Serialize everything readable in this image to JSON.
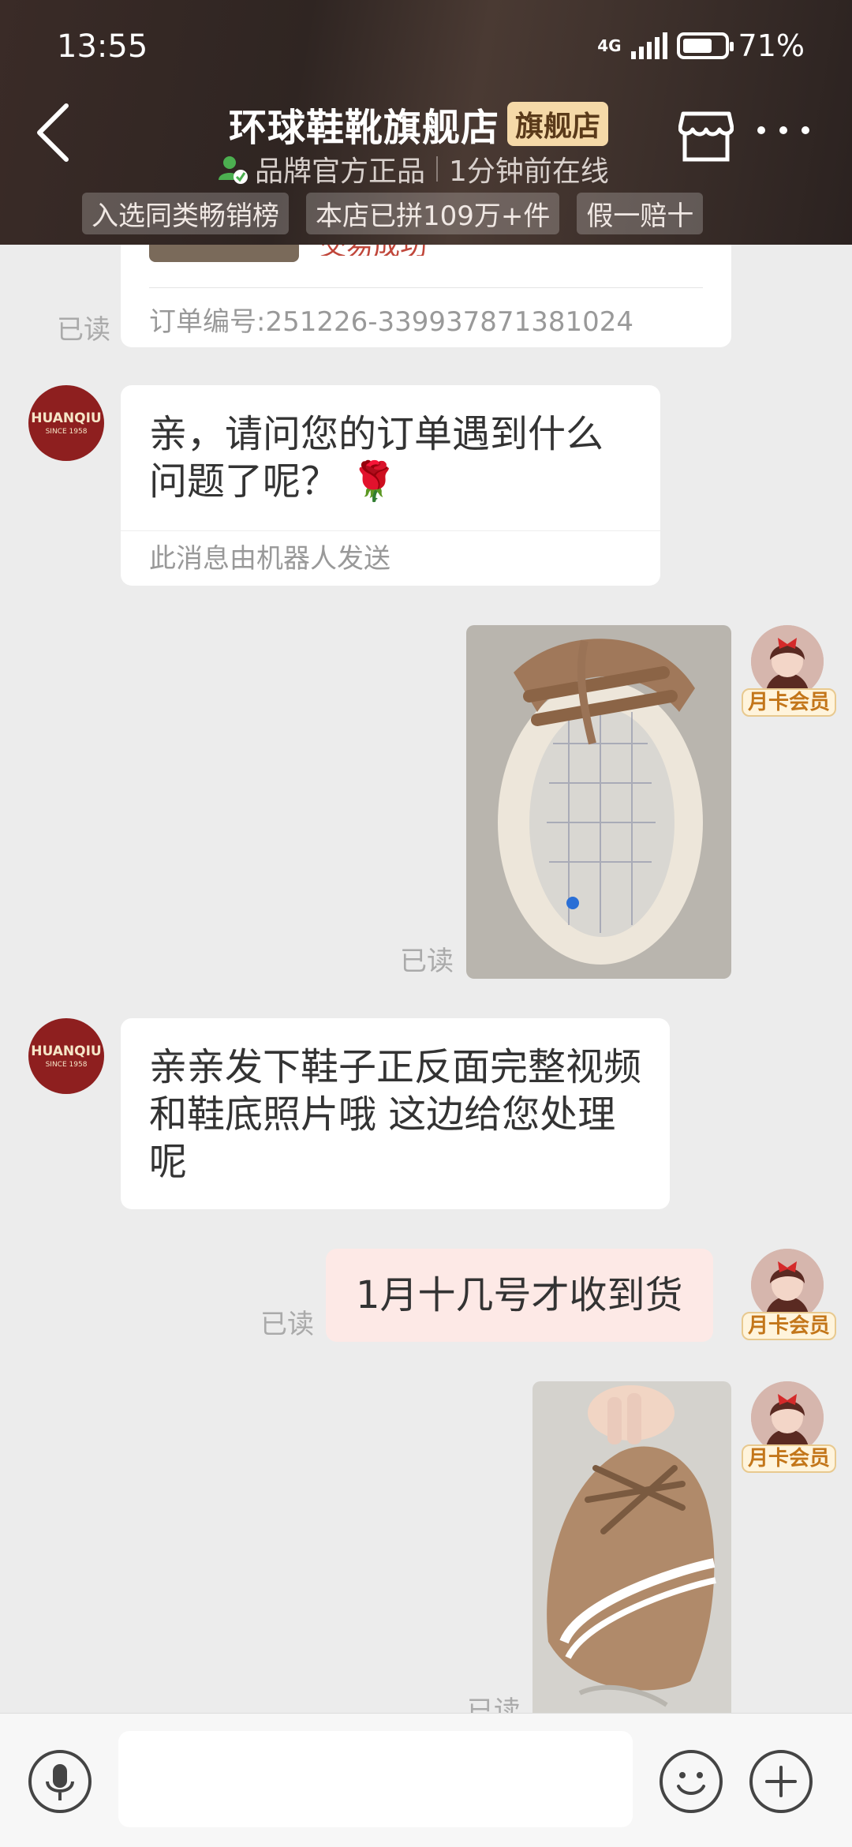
{
  "status_bar": {
    "time": "13:55",
    "network": "4G",
    "battery": "71%"
  },
  "header": {
    "title": "环球鞋靴旗舰店",
    "flag": "旗舰店",
    "official": "品牌官方正品",
    "online": "1分钟前在线",
    "badges": [
      "入选同类畅销榜",
      "本店已拼109万+件",
      "假一赔十"
    ]
  },
  "order_card": {
    "status": "交易成功",
    "order_no": "订单编号:251226-3399378713810​24"
  },
  "shop_avatar": {
    "brand": "HUANQIU",
    "since": "SINCE 1958"
  },
  "member_badge": "月卡会员",
  "read_label": "已读",
  "messages": {
    "m1": "亲，请问您的订单遇到什么问题了呢？ 🌹",
    "m1_robot": "此消息由机器人发送",
    "m2": "亲亲发下鞋子正反面完整视频和鞋底照片哦 这边给您处理呢",
    "m3": "1月十几号才收到货"
  },
  "colors": {
    "header_bg": "#2f2522",
    "self_bubble": "#fde9e6",
    "member_text": "#c3761a",
    "shop_avatar": "#8e1f1f"
  }
}
